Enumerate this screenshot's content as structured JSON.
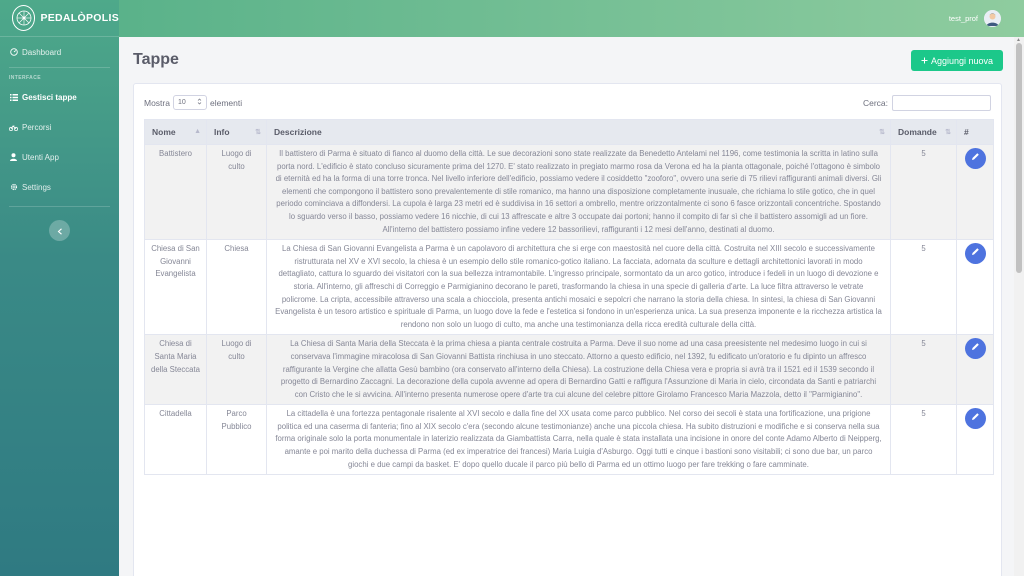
{
  "brand": {
    "name": "PEDALÒPOLIS"
  },
  "sidebar": {
    "dashboard": "Dashboard",
    "heading": "INTERFACE",
    "items": [
      {
        "label": "Gestisci tappe",
        "icon": "list-icon"
      },
      {
        "label": "Percorsi",
        "icon": "bicycle-icon"
      },
      {
        "label": "Utenti App",
        "icon": "user-icon"
      },
      {
        "label": "Settings",
        "icon": "gear-icon"
      }
    ]
  },
  "topbar": {
    "username": "test_prof"
  },
  "page": {
    "title": "Tappe",
    "add_label": "Aggiungi nuova"
  },
  "table_controls": {
    "show": "Mostra",
    "page_size": "10",
    "entries": "elementi",
    "search_label": "Cerca:"
  },
  "table": {
    "columns": [
      "Nome",
      "Info",
      "Descrizione",
      "Domande",
      "#"
    ],
    "rows": [
      {
        "nome": "Battistero",
        "info": "Luogo di culto",
        "descrizione": "Il battistero di Parma è situato di fianco al duomo della città. Le sue decorazioni sono state realizzate da Benedetto Antelami nel 1196, come testimonia la scritta in latino sulla porta nord. L'edificio è stato concluso sicuramente prima del 1270. E' stato realizzato in pregiato marmo rosa da Verona ed ha la pianta ottagonale, poiché l'ottagono è simbolo di eternità ed ha la forma di una torre tronca. Nel livello inferiore dell'edificio, possiamo vedere il cosiddetto \"zooforo\", ovvero una serie di 75 rilievi raffiguranti animali diversi. Gli elementi che compongono il battistero sono prevalentemente di stile romanico, ma hanno una disposizione completamente inusuale, che richiama lo stile gotico, che in quel periodo cominciava a diffondersi. La cupola è larga 23 metri ed è suddivisa in 16 settori a ombrello, mentre orizzontalmente ci sono 6 fasce orizzontali concentriche. Spostando lo sguardo verso il basso, possiamo vedere 16 nicchie, di cui 13 affrescate e altre 3 occupate dai portoni; hanno il compito di far sì che il battistero assomigli ad un fiore. All'interno del battistero possiamo infine vedere 12 bassorilievi, raffiguranti i 12 mesi dell'anno, destinati al duomo.",
        "domande": "5"
      },
      {
        "nome": "Chiesa di San Giovanni Evangelista",
        "info": "Chiesa",
        "descrizione": "La Chiesa di San Giovanni Evangelista a Parma è un capolavoro di architettura che si erge con maestosità nel cuore della città. Costruita nel XIII secolo e successivamente ristrutturata nel XV e XVI secolo, la chiesa è un esempio dello stile romanico-gotico italiano. La facciata, adornata da sculture e dettagli architettonici lavorati in modo dettagliato, cattura lo sguardo dei visitatori con la sua bellezza intramontabile. L'ingresso principale, sormontato da un arco gotico, introduce i fedeli in un luogo di devozione e storia. All'interno, gli affreschi di Correggio e Parmigianino decorano le pareti, trasformando la chiesa in una specie di galleria d'arte. La luce filtra attraverso le vetrate policrome. La cripta, accessibile attraverso una scala a chiocciola, presenta antichi mosaici e sepolcri che narrano la storia della chiesa. In sintesi, la chiesa di San Giovanni Evangelista è un tesoro artistico e spirituale di Parma, un luogo dove la fede e l'estetica si fondono in un'esperienza unica. La sua presenza imponente e la ricchezza artistica la rendono non solo un luogo di culto, ma anche una testimonianza della ricca eredità culturale della città.",
        "domande": "5"
      },
      {
        "nome": "Chiesa di Santa Maria della Steccata",
        "info": "Luogo di culto",
        "descrizione": "La Chiesa di Santa Maria della Steccata è la prima chiesa a pianta centrale costruita a Parma. Deve il suo nome ad una casa preesistente nel medesimo luogo in cui si conservava l'immagine miracolosa di San Giovanni Battista rinchiusa in uno steccato. Attorno a questo edificio, nel 1392, fu edificato un'oratorio e fu dipinto un affresco raffigurante la Vergine che allatta Gesù bambino (ora conservato all'interno della Chiesa). La costruzione della Chiesa vera e propria si avrà tra il 1521 ed il 1539 secondo il progetto di Bernardino Zaccagni. La decorazione della cupola avvenne ad opera di Bernardino Gatti e raffigura l'Assunzione di Maria in cielo, circondata da Santi e patriarchi con Cristo che le si avvicina. All'interno presenta numerose opere d'arte tra cui alcune del celebre pittore Girolamo Francesco Maria Mazzola, detto il \"Parmigianino\".",
        "domande": "5"
      },
      {
        "nome": "Cittadella",
        "info": "Parco Pubblico",
        "descrizione": "La cittadella è una fortezza pentagonale risalente al XVI secolo e dalla fine del XX usata come parco pubblico. Nel corso dei secoli è stata una fortificazione, una prigione politica ed una caserma di fanteria; fino al XIX secolo c'era (secondo alcune testimonianze) anche una piccola chiesa. Ha subito distruzioni e modifiche e si conserva nella sua forma originale solo la porta monumentale in laterizio realizzata da Giambattista Carra, nella quale è stata installata una incisione in onore del conte Adamo Alberto di Neipperg, amante e poi marito della duchessa di Parma (ed ex imperatrice dei francesi) Maria Luigia d'Asburgo. Oggi tutti e cinque i bastioni sono visitabili; ci sono due bar, un parco giochi e due campi da basket. E' dopo quello ducale il parco più bello di Parma ed un ottimo luogo per fare trekking o fare camminate.",
        "domande": "5"
      }
    ]
  }
}
